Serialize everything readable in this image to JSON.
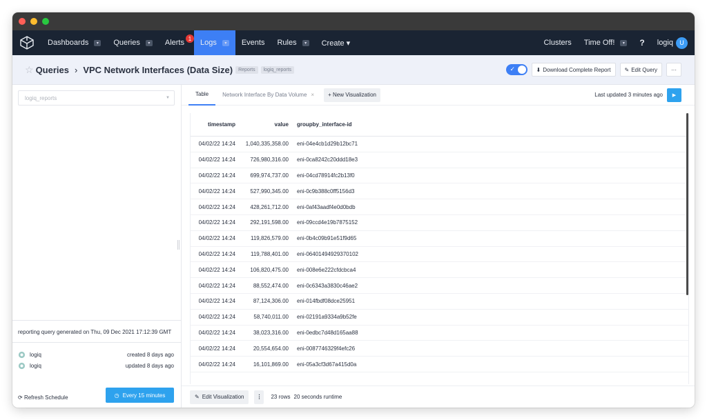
{
  "nav": {
    "items": [
      {
        "label": "Dashboards",
        "has_caret": true
      },
      {
        "label": "Queries",
        "has_caret": true
      },
      {
        "label": "Alerts",
        "badge": "1"
      },
      {
        "label": "Logs",
        "has_caret": true,
        "active": true
      },
      {
        "label": "Events"
      },
      {
        "label": "Rules",
        "has_caret": true
      },
      {
        "label": "Create ▾"
      }
    ],
    "right": {
      "clusters": "Clusters",
      "timeoff": "Time Off!",
      "help": "?",
      "user": "logiq",
      "avatar": "U"
    }
  },
  "header": {
    "crumb_root": "Queries",
    "title": "VPC Network Interfaces (Data Size)",
    "tags": [
      "Reports",
      "logiq_reports"
    ],
    "download_label": "Download Complete Report",
    "edit_label": "Edit Query",
    "more_label": "···"
  },
  "left": {
    "select_value": "logiq_reports",
    "info": "reporting query generated on Thu, 09 Dec 2021 17:12:39 GMT",
    "meta": [
      {
        "user": "logiq",
        "text": "created 8 days ago"
      },
      {
        "user": "logiq",
        "text": "updated 8 days ago"
      }
    ],
    "refresh_label": "Refresh Schedule",
    "schedule_label": "Every 15 minutes"
  },
  "tabs": {
    "items": [
      "Table",
      "Network Interface By Data Volume"
    ],
    "new_label": "+ New Visualization",
    "last_updated": "Last updated 3 minutes ago"
  },
  "table": {
    "columns": [
      "timestamp",
      "value",
      "groupby_interface-id"
    ],
    "rows": [
      [
        "04/02/22 14:24",
        "1,040,335,358.00",
        "eni-04e4cb1d29b12bc71"
      ],
      [
        "04/02/22 14:24",
        "726,980,316.00",
        "eni-0ca8242c20ddd18e3"
      ],
      [
        "04/02/22 14:24",
        "699,974,737.00",
        "eni-04cd78914fc2b13f0"
      ],
      [
        "04/02/22 14:24",
        "527,990,345.00",
        "eni-0c9b388c0ff5156d3"
      ],
      [
        "04/02/22 14:24",
        "428,261,712.00",
        "eni-0af43aadf4e0d0bdb"
      ],
      [
        "04/02/22 14:24",
        "292,191,598.00",
        "eni-09ccd4e19b7875152"
      ],
      [
        "04/02/22 14:24",
        "119,826,579.00",
        "eni-0b4c09b91e51f9d65"
      ],
      [
        "04/02/22 14:24",
        "119,788,401.00",
        "eni-06401494929370102"
      ],
      [
        "04/02/22 14:24",
        "106,820,475.00",
        "eni-008e6e222cfdcbca4"
      ],
      [
        "04/02/22 14:24",
        "88,552,474.00",
        "eni-0c6343a3830c46ae2"
      ],
      [
        "04/02/22 14:24",
        "87,124,306.00",
        "eni-014fbdf08dce25951"
      ],
      [
        "04/02/22 14:24",
        "58,740,011.00",
        "eni-02191a9334a9b52fe"
      ],
      [
        "04/02/22 14:24",
        "38,023,316.00",
        "eni-0edbc7d48d165aa88"
      ],
      [
        "04/02/22 14:24",
        "20,554,654.00",
        "eni-0087746329f4efc26"
      ],
      [
        "04/02/22 14:24",
        "16,101,869.00",
        "eni-05a3cf3d67a415d0a"
      ]
    ]
  },
  "bottom": {
    "edit_label": "Edit Visualization",
    "rows_count": "23 rows",
    "runtime": "20 seconds runtime"
  }
}
